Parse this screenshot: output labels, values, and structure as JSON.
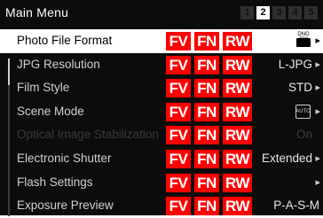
{
  "header": {
    "title": "Main Menu",
    "pages": [
      "1",
      "2",
      "3",
      "4",
      "5"
    ],
    "active_page_index": 1
  },
  "overlay": {
    "badges": [
      "FV",
      "FN",
      "RW"
    ]
  },
  "menu": {
    "items": [
      {
        "label": "Photo File Format",
        "value": "",
        "icon": "dng-jpg-format-icon",
        "icon_text": "DNG JPG",
        "selected": true
      },
      {
        "label": "JPG Resolution",
        "value": "L-JPG"
      },
      {
        "label": "Film Style",
        "value": "STD"
      },
      {
        "label": "Scene Mode",
        "value": "",
        "icon": "auto-mode-icon",
        "icon_text": "AUTO"
      },
      {
        "label": "Optical Image Stabilization",
        "value": "On",
        "disabled": true
      },
      {
        "label": "Electronic Shutter",
        "value": "Extended"
      },
      {
        "label": "Flash Settings",
        "value": ""
      },
      {
        "label": "Exposure Preview",
        "value": "P-A-S-M"
      }
    ]
  },
  "colors": {
    "background": "#0c0c0c",
    "badge": "#ff0000",
    "selected_row": "#ffffff"
  }
}
